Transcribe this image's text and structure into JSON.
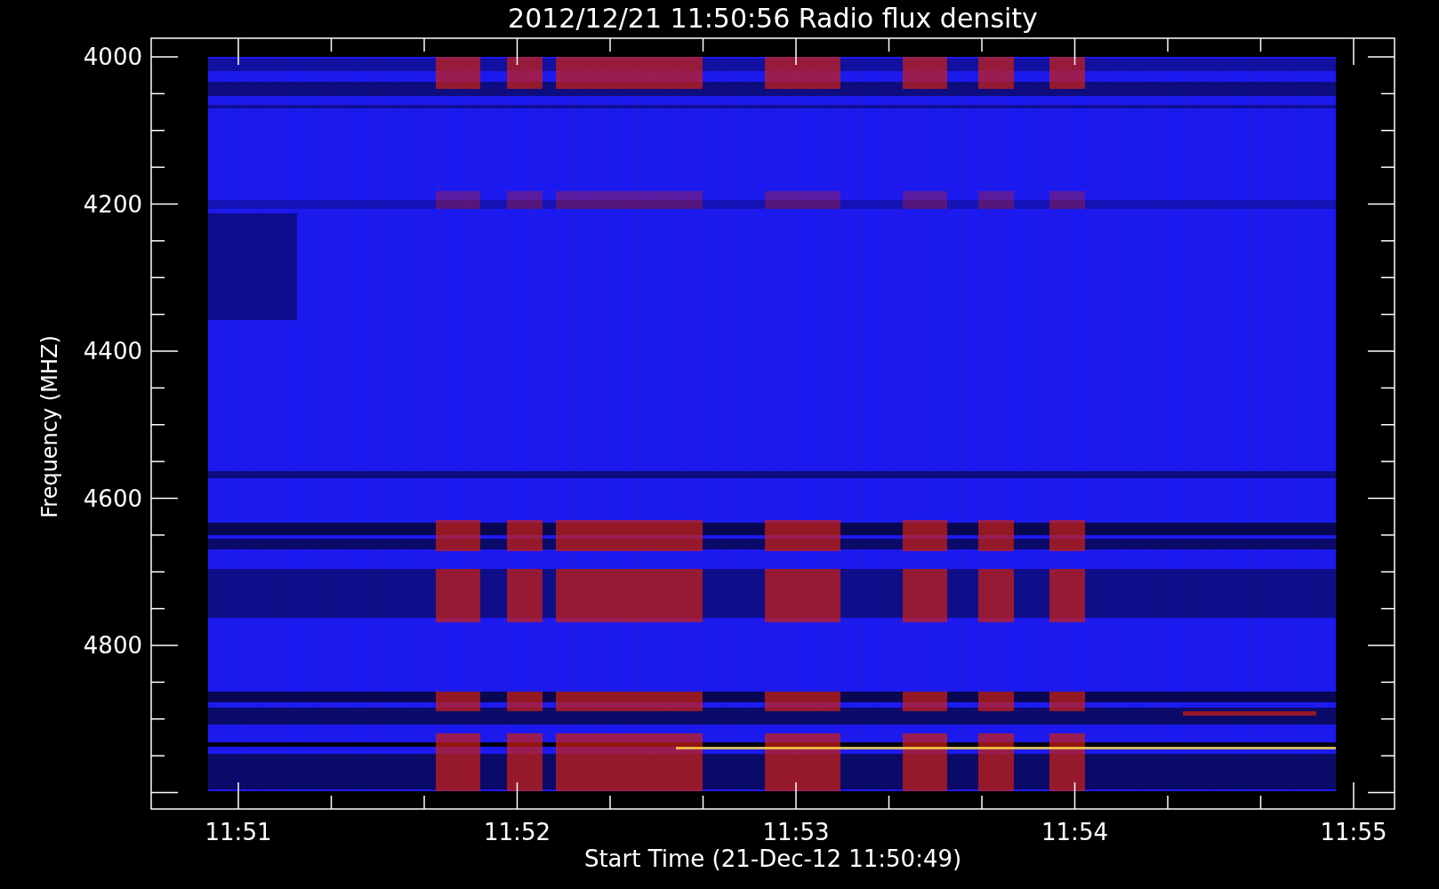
{
  "plot": {
    "title": "2012/12/21 11:50:56 Radio flux density",
    "ylabel": "Frequency (MHZ)",
    "xlabel": "Start Time (21-Dec-12 11:50:49)",
    "y_tick_labels": [
      "4000",
      "4200",
      "4400",
      "4600",
      "4800"
    ],
    "x_tick_labels": [
      "11:51",
      "11:52",
      "11:53",
      "11:54",
      "11:55"
    ]
  }
}
